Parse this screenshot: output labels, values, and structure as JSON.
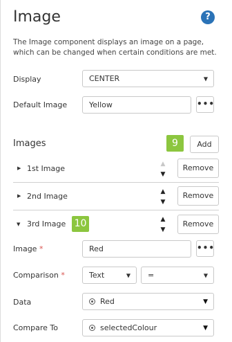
{
  "header": {
    "title": "Image",
    "help_icon": "?"
  },
  "description": "The Image component displays an image on a page, which can be changed when certain conditions are met.",
  "display": {
    "label": "Display",
    "value": "CENTER"
  },
  "default_image": {
    "label": "Default Image",
    "value": "Yellow",
    "picker_label": "•••"
  },
  "images_section": {
    "title": "Images",
    "add_label": "Add",
    "badge": "9"
  },
  "image_rows": [
    {
      "label": "1st Image",
      "expanded": false,
      "remove_label": "Remove"
    },
    {
      "label": "2nd Image",
      "expanded": false,
      "remove_label": "Remove"
    },
    {
      "label": "3rd Image",
      "expanded": true,
      "remove_label": "Remove",
      "badge": "10"
    }
  ],
  "detail": {
    "image": {
      "label": "Image",
      "required": "*",
      "value": "Red",
      "picker_label": "•••"
    },
    "comparison": {
      "label": "Comparison",
      "required": "*",
      "type_value": "Text",
      "operator_value": "="
    },
    "data": {
      "label": "Data",
      "value": "Red"
    },
    "compare_to": {
      "label": "Compare To",
      "value": "selectedColour"
    }
  },
  "colors": {
    "accent_badge": "#8cc63f",
    "help": "#2b73b7",
    "required": "#d9534f"
  }
}
